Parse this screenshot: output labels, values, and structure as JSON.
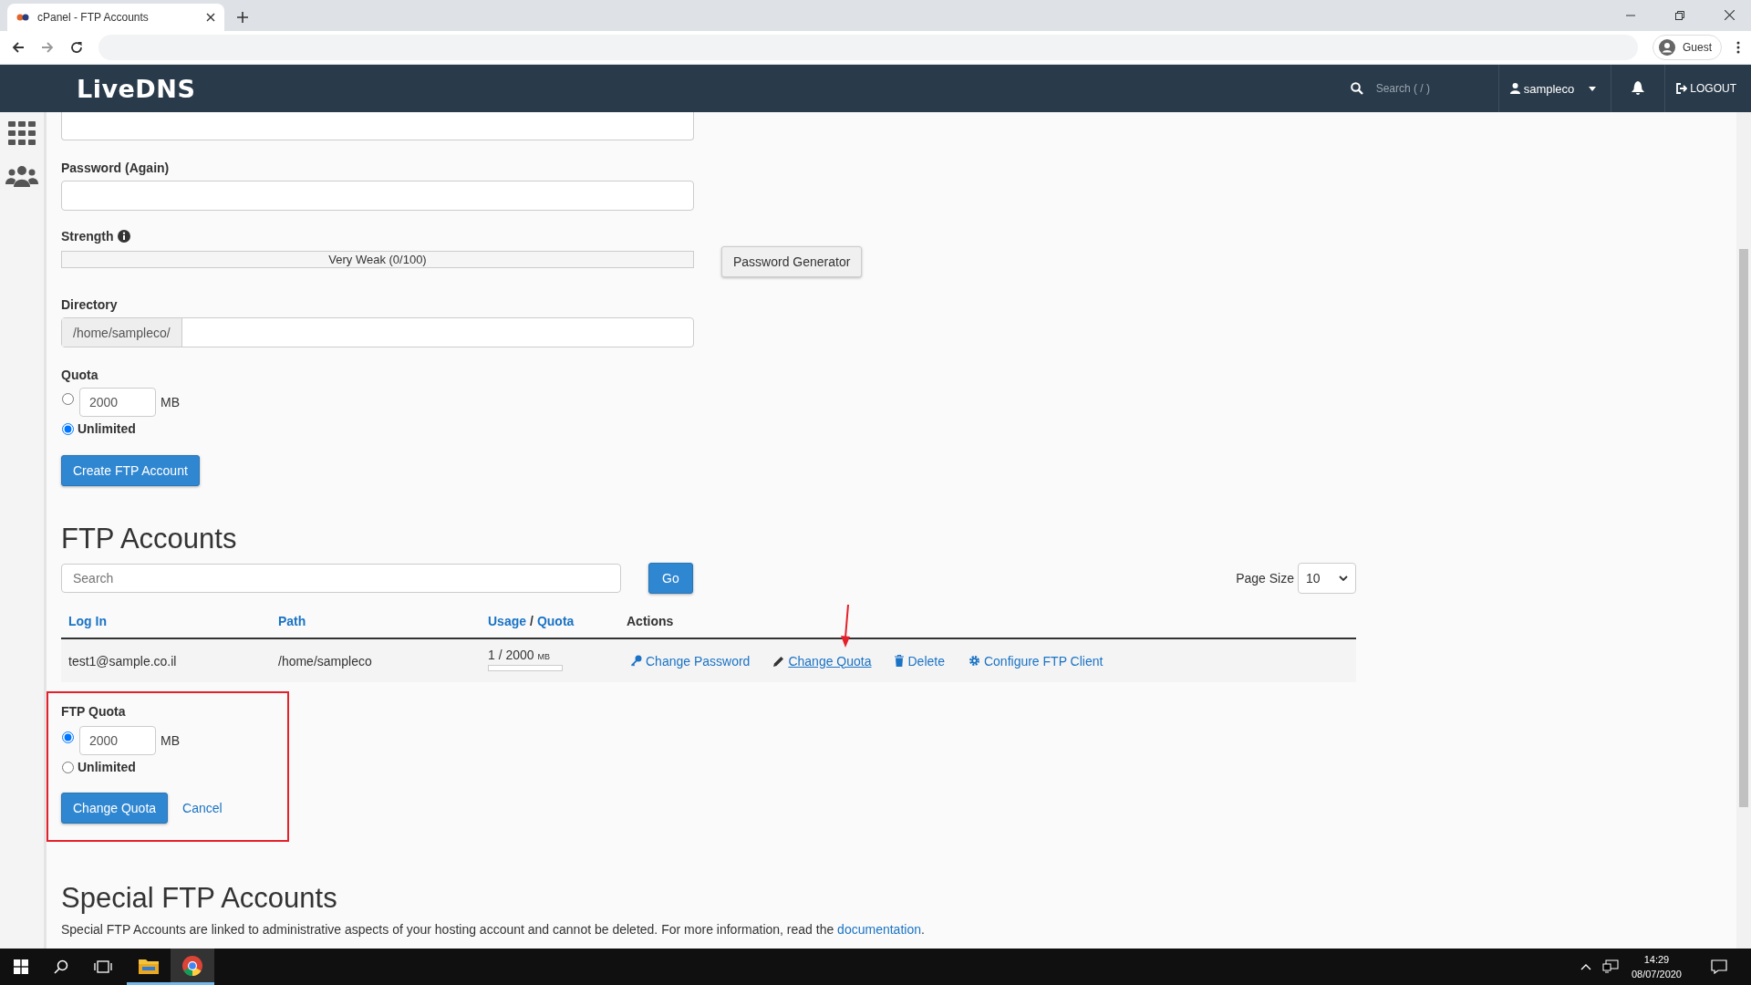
{
  "browser": {
    "tab_title": "cPanel - FTP Accounts",
    "profile": "Guest"
  },
  "header": {
    "logo": "LiveDNS",
    "search_placeholder": "Search ( / )",
    "user": "sampleco",
    "logout": "LOGOUT"
  },
  "form": {
    "password_again_label": "Password (Again)",
    "strength_label": "Strength",
    "strength": {
      "text": "Very Weak (0/100)",
      "level": 0
    },
    "generator_button": "Password Generator",
    "directory_label": "Directory",
    "directory_prefix": "/home/sampleco/",
    "quota_label": "Quota",
    "quota_value": "2000",
    "quota_unit": "MB",
    "quota_options": [
      {
        "kind": "limited",
        "selected": false
      },
      {
        "kind": "unlimited",
        "label": "Unlimited",
        "selected": true
      }
    ],
    "create_button": "Create FTP Account"
  },
  "accounts": {
    "heading": "FTP Accounts",
    "search_placeholder": "Search",
    "go_button": "Go",
    "page_size_label": "Page Size",
    "page_size": "10",
    "columns": [
      {
        "parts": [
          {
            "text": "Log In",
            "link": true
          }
        ]
      },
      {
        "parts": [
          {
            "text": "Path",
            "link": true
          }
        ]
      },
      {
        "parts": [
          {
            "text": "Usage",
            "link": true
          },
          {
            "text": "/",
            "link": false
          },
          {
            "text": "Quota",
            "link": true
          }
        ]
      },
      {
        "parts": [
          {
            "text": "Actions",
            "link": false
          }
        ]
      }
    ],
    "rows": [
      {
        "login": "test1@sample.co.il",
        "path": "/home/sampleco",
        "usage": "1 / 2000",
        "usage_unit": "MB",
        "level": 0.0005,
        "actions": [
          {
            "kind": "password",
            "label": "Change Password",
            "selected": false
          },
          {
            "kind": "quota",
            "label": "Change Quota",
            "selected": true
          },
          {
            "kind": "delete",
            "label": "Delete",
            "selected": false
          },
          {
            "kind": "configure",
            "label": "Configure FTP Client",
            "selected": false
          }
        ]
      }
    ]
  },
  "quota_editor": {
    "highlighted": true,
    "title": "FTP Quota",
    "value": "2000",
    "unit": "MB",
    "options": [
      {
        "kind": "limited",
        "selected": true
      },
      {
        "kind": "unlimited",
        "label": "Unlimited",
        "selected": false
      }
    ],
    "submit": "Change Quota",
    "cancel": "Cancel"
  },
  "special": {
    "heading": "Special FTP Accounts",
    "text": "Special FTP Accounts are linked to administrative aspects of your hosting account and cannot be deleted. For more information, read the",
    "link": "documentation",
    "end": "."
  },
  "taskbar": {
    "time": "14:29",
    "date": "08/07/2020"
  }
}
